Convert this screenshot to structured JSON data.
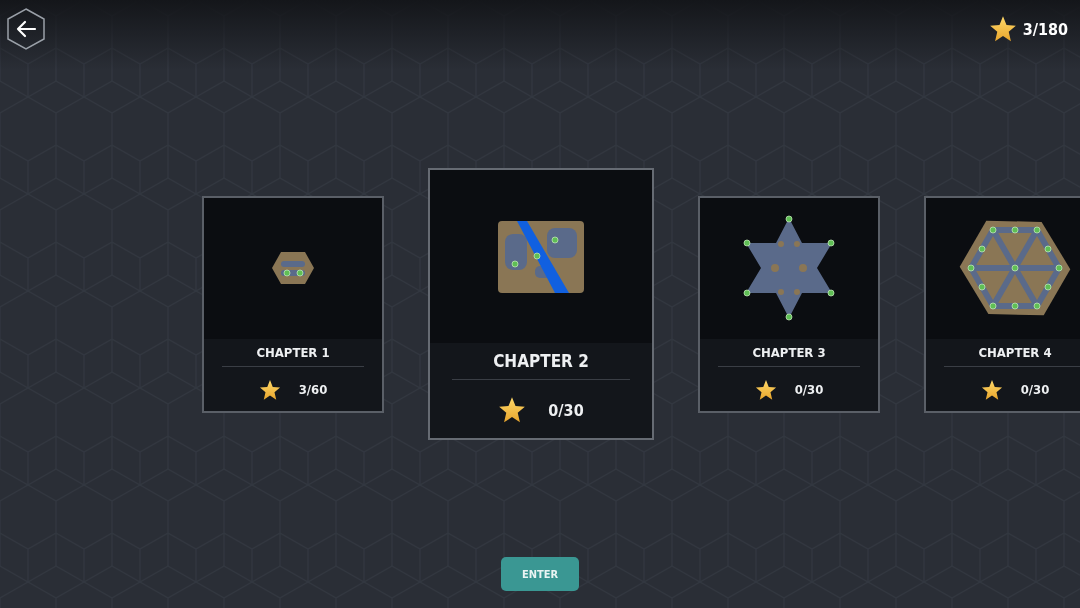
{
  "header": {
    "total_stars": "3/180"
  },
  "chapters": [
    {
      "title": "CHAPTER 1",
      "stars": "3/60",
      "selected": false,
      "kind": "small"
    },
    {
      "title": "CHAPTER 2",
      "stars": "0/30",
      "selected": true,
      "kind": "river"
    },
    {
      "title": "CHAPTER 3",
      "stars": "0/30",
      "selected": false,
      "kind": "star"
    },
    {
      "title": "CHAPTER 4",
      "stars": "0/30",
      "selected": false,
      "kind": "hexagon"
    }
  ],
  "enter_button": "ENTER"
}
